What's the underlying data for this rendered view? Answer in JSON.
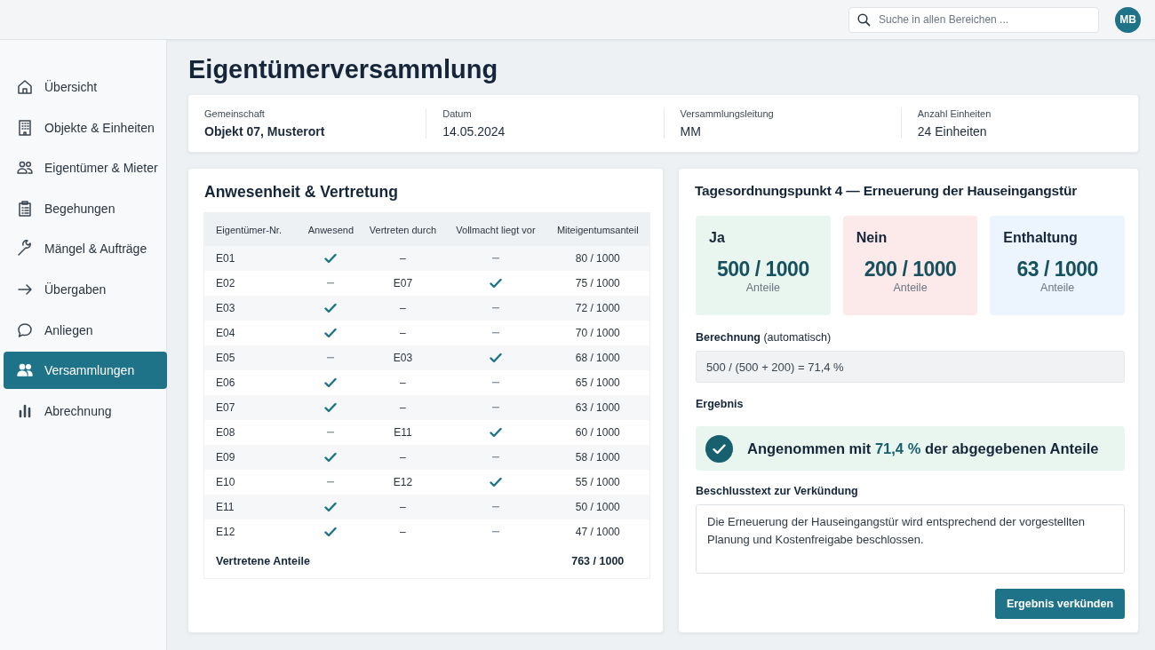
{
  "search": {
    "placeholder": "Suche in allen Bereichen ..."
  },
  "user": {
    "initials": "MB"
  },
  "sidebar": {
    "items": [
      {
        "label": "Übersicht",
        "selected": false
      },
      {
        "label": "Objekte & Einheiten",
        "selected": false
      },
      {
        "label": "Eigentümer & Mieter",
        "selected": false
      },
      {
        "label": "Begehungen",
        "selected": false
      },
      {
        "label": "Mängel & Aufträge",
        "selected": false
      },
      {
        "label": "Übergaben",
        "selected": false
      },
      {
        "label": "Anliegen",
        "selected": false
      },
      {
        "label": "Versammlungen",
        "selected": true
      },
      {
        "label": "Abrechnung",
        "selected": false
      }
    ]
  },
  "page_title": "Eigentümerversammlung",
  "info": [
    {
      "label": "Gemeinschaft",
      "value": "Objekt 07, Musterort",
      "bold": true
    },
    {
      "label": "Datum",
      "value": "14.05.2024",
      "bold": false
    },
    {
      "label": "Versammlungsleitung",
      "value": "MM",
      "bold": false
    },
    {
      "label": "Anzahl Einheiten",
      "value": "24 Einheiten",
      "bold": false
    }
  ],
  "attendance": {
    "title": "Anwesenheit & Vertretung",
    "columns": [
      "Eigentümer-Nr.",
      "Anwesend",
      "Vertreten durch",
      "Vollmacht liegt vor",
      "Miteigentumsanteil"
    ],
    "rows": [
      {
        "owner": "E01",
        "present": true,
        "represented_by": "–",
        "proxy": false,
        "share": "80 / 1000"
      },
      {
        "owner": "E02",
        "present": false,
        "represented_by": "E07",
        "proxy": true,
        "share": "75 / 1000"
      },
      {
        "owner": "E03",
        "present": true,
        "represented_by": "–",
        "proxy": false,
        "share": "72 / 1000"
      },
      {
        "owner": "E04",
        "present": true,
        "represented_by": "–",
        "proxy": false,
        "share": "70 / 1000"
      },
      {
        "owner": "E05",
        "present": false,
        "represented_by": "E03",
        "proxy": true,
        "share": "68 / 1000"
      },
      {
        "owner": "E06",
        "present": true,
        "represented_by": "–",
        "proxy": false,
        "share": "65 / 1000"
      },
      {
        "owner": "E07",
        "present": true,
        "represented_by": "–",
        "proxy": false,
        "share": "63 / 1000"
      },
      {
        "owner": "E08",
        "present": false,
        "represented_by": "E11",
        "proxy": true,
        "share": "60 / 1000"
      },
      {
        "owner": "E09",
        "present": true,
        "represented_by": "–",
        "proxy": false,
        "share": "58 / 1000"
      },
      {
        "owner": "E10",
        "present": false,
        "represented_by": "E12",
        "proxy": true,
        "share": "55 / 1000"
      },
      {
        "owner": "E11",
        "present": true,
        "represented_by": "–",
        "proxy": false,
        "share": "50 / 1000"
      },
      {
        "owner": "E12",
        "present": true,
        "represented_by": "–",
        "proxy": false,
        "share": "47 / 1000"
      }
    ],
    "total": {
      "label": "Vertretene Anteile",
      "value": "763 / 1000"
    }
  },
  "vote": {
    "title": "Tagesordnungspunkt 4 — Erneuerung der Hauseingangstür",
    "results": [
      {
        "label": "Ja",
        "value": "500 / 1000",
        "unit": "Anteile",
        "color": "#e9f6ef"
      },
      {
        "label": "Nein",
        "value": "200 / 1000",
        "unit": "Anteile",
        "color": "#fce9ea"
      },
      {
        "label": "Enthaltung",
        "value": "63 / 1000",
        "unit": "Anteile",
        "color": "#ecf4fd"
      }
    ],
    "calculation_label": "**Berechnung** (automatisch)",
    "calculation": "500 / (500 + 200) = 71,4 %",
    "result_label": "Ergebnis",
    "result": "Angenommen mit **71,4 %** der abgegebenen Anteile",
    "resolution_label": "Beschlusstext zur Verkündung",
    "resolution": "Die Erneuerung der Hauseingangstür wird entsprechend der vorgestellten Planung und Kostenfreigabe beschlossen.",
    "button": "Ergebnis verkünden"
  }
}
